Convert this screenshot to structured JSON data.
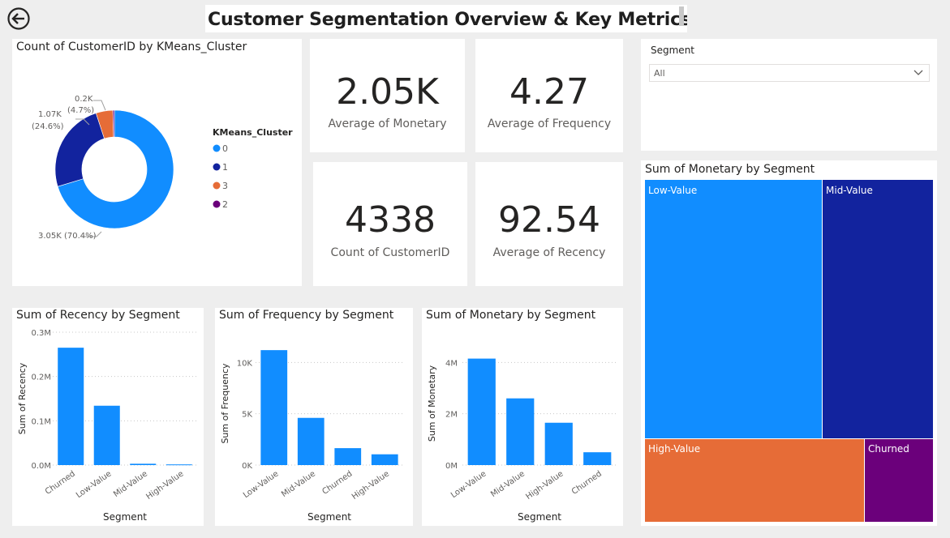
{
  "page": {
    "title": "Customer Segmentation Overview & Key Metrics"
  },
  "donut": {
    "title": "Count of CustomerID by KMeans_Cluster",
    "legend_title": "KMeans_Cluster",
    "legend": [
      {
        "label": "0",
        "color": "#118DFF"
      },
      {
        "label": "1",
        "color": "#12239E"
      },
      {
        "label": "3",
        "color": "#E66C37"
      },
      {
        "label": "2",
        "color": "#6B007B"
      }
    ],
    "labels": {
      "c0": "3.05K (70.4%)",
      "c1_value": "1.07K",
      "c1_pct": "(24.6%)",
      "c3_value": "0.2K",
      "c3_pct": "(4.7%)"
    }
  },
  "kpis": [
    {
      "value": "2.05K",
      "label": "Average of Monetary"
    },
    {
      "value": "4.27",
      "label": "Average of Frequency"
    },
    {
      "value": "4338",
      "label": "Count of CustomerID"
    },
    {
      "value": "92.54",
      "label": "Average of Recency"
    }
  ],
  "slicer": {
    "label": "Segment",
    "value": "All"
  },
  "treemap": {
    "title": "Sum of Monetary by Segment",
    "items": [
      {
        "label": "Low-Value",
        "color": "#118DFF"
      },
      {
        "label": "Mid-Value",
        "color": "#12239E"
      },
      {
        "label": "High-Value",
        "color": "#E66C37"
      },
      {
        "label": "Churned",
        "color": "#6B007B"
      }
    ]
  },
  "bar_titles": {
    "recency": "Sum of Recency by Segment",
    "frequency": "Sum of Frequency by Segment",
    "monetary": "Sum of Monetary by Segment"
  },
  "chart_data": [
    {
      "type": "pie",
      "title": "Count of CustomerID by KMeans_Cluster",
      "legend_title": "KMeans_Cluster",
      "categories": [
        "0",
        "1",
        "3",
        "2"
      ],
      "values": [
        3050,
        1070,
        200,
        18
      ],
      "data_labels": [
        "3.05K (70.4%)",
        "1.07K (24.6%)",
        "0.2K (4.7%)",
        ""
      ],
      "legend_position": "right"
    },
    {
      "type": "bar",
      "title": "Sum of Recency by Segment",
      "xlabel": "Segment",
      "ylabel": "Sum of Recency",
      "categories": [
        "Churned",
        "Low-Value",
        "Mid-Value",
        "High-Value"
      ],
      "values": [
        265000,
        134000,
        3000,
        1500
      ],
      "ylim": [
        0,
        300000
      ],
      "yticks": [
        0,
        100000,
        200000,
        300000
      ],
      "ytick_labels": [
        "0.0M",
        "0.1M",
        "0.2M",
        "0.3M"
      ],
      "grid": true
    },
    {
      "type": "bar",
      "title": "Sum of Frequency by Segment",
      "xlabel": "Segment",
      "ylabel": "Sum of Frequency",
      "categories": [
        "Low-Value",
        "Mid-Value",
        "Churned",
        "High-Value"
      ],
      "values": [
        11200,
        4600,
        1650,
        1050
      ],
      "ylim": [
        0,
        12000
      ],
      "yticks": [
        0,
        5000,
        10000
      ],
      "ytick_labels": [
        "0K",
        "5K",
        "10K"
      ],
      "grid": true
    },
    {
      "type": "bar",
      "title": "Sum of Monetary by Segment",
      "xlabel": "Segment",
      "ylabel": "Sum of Monetary",
      "categories": [
        "Low-Value",
        "Mid-Value",
        "High-Value",
        "Churned"
      ],
      "values": [
        4150000,
        2600000,
        1650000,
        500000
      ],
      "ylim": [
        0,
        4800000
      ],
      "yticks": [
        0,
        2000000,
        4000000
      ],
      "ytick_labels": [
        "0M",
        "2M",
        "4M"
      ],
      "grid": true
    },
    {
      "type": "treemap",
      "title": "Sum of Monetary by Segment",
      "categories": [
        "Low-Value",
        "Mid-Value",
        "High-Value",
        "Churned"
      ],
      "values": [
        4150000,
        2600000,
        1650000,
        500000
      ]
    }
  ]
}
